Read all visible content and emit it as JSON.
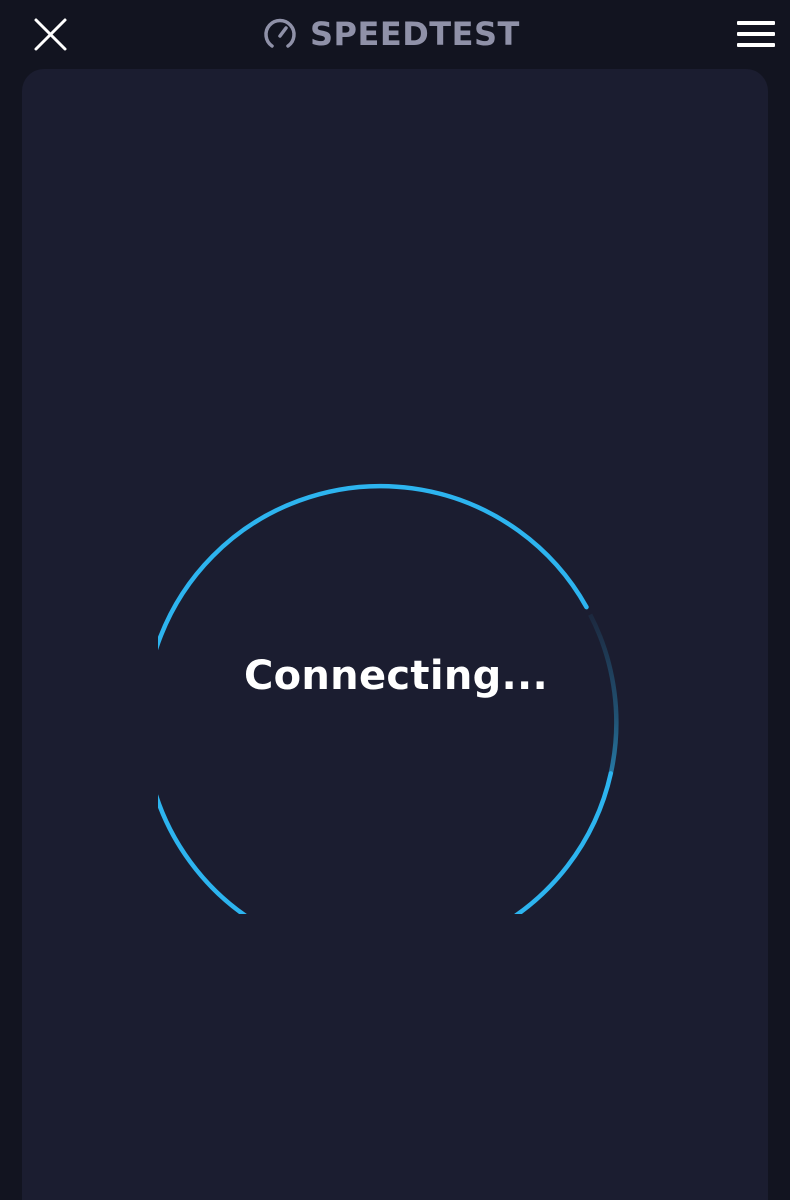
{
  "header": {
    "title": "SPEEDTEST",
    "close_icon": "close-icon",
    "logo_icon": "speedometer-icon",
    "menu_icon": "hamburger-menu-icon"
  },
  "main": {
    "status_text": "Connecting..."
  },
  "colors": {
    "background": "#121420",
    "card": "#1b1d30",
    "accent": "#2db4ef",
    "title": "#8f91a8",
    "text": "#ffffff"
  }
}
